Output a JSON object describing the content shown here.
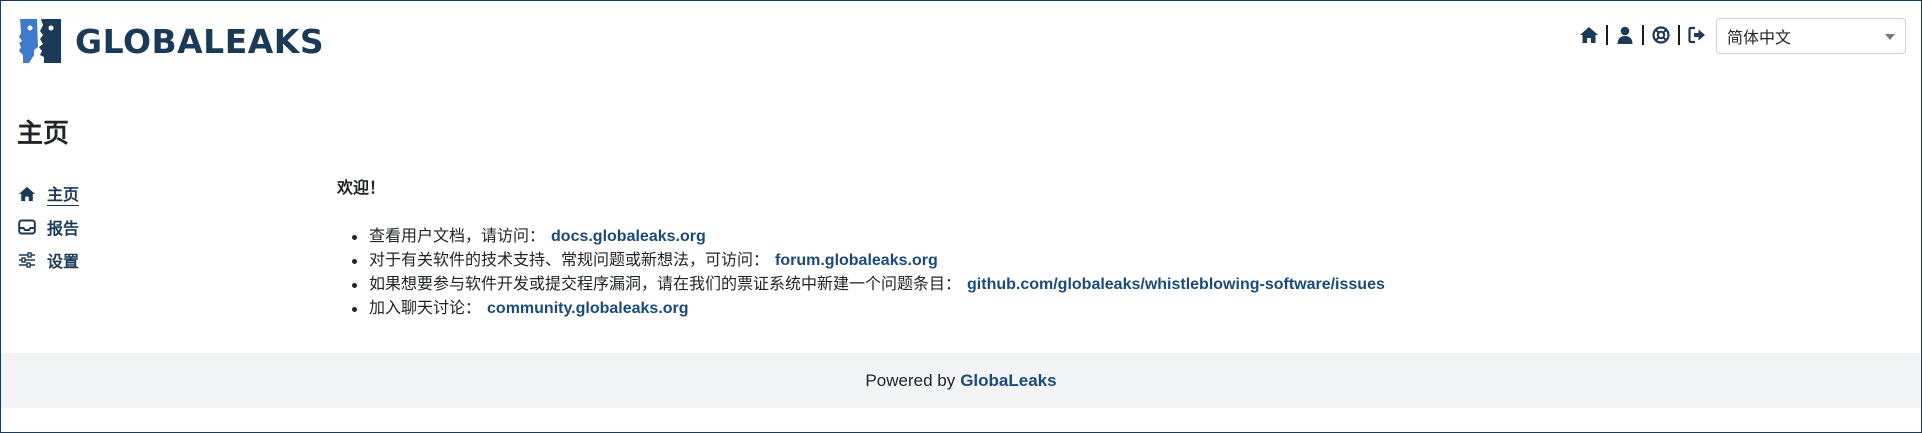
{
  "header": {
    "logo_text": "GLOBALEAKS",
    "icons": [
      "home-icon",
      "user-icon",
      "support-icon",
      "logout-icon"
    ],
    "language": {
      "selected": "简体中文"
    }
  },
  "page": {
    "title": "主页"
  },
  "sidebar": {
    "items": [
      {
        "label": "主页",
        "icon": "home-icon",
        "active": true
      },
      {
        "label": "报告",
        "icon": "inbox-icon",
        "active": false
      },
      {
        "label": "设置",
        "icon": "sliders-icon",
        "active": false
      }
    ]
  },
  "main": {
    "welcome": "欢迎！",
    "links": [
      {
        "text": "查看用户文档，请访问：",
        "link": "docs.globaleaks.org"
      },
      {
        "text": "对于有关软件的技术支持、常规问题或新想法，可访问：",
        "link": "forum.globaleaks.org"
      },
      {
        "text": "如果想要参与软件开发或提交程序漏洞，请在我们的票证系统中新建一个问题条目：",
        "link": "github.com/globaleaks/whistleblowing-software/issues"
      },
      {
        "text": "加入聊天讨论：",
        "link": "community.globaleaks.org"
      }
    ]
  },
  "footer": {
    "text": "Powered by",
    "link": "GlobaLeaks"
  },
  "colors": {
    "brand": "#1b3a57",
    "link": "#1b4b7a",
    "logo_light": "#3d7cc9",
    "footer_bg": "#f3f4f6"
  }
}
